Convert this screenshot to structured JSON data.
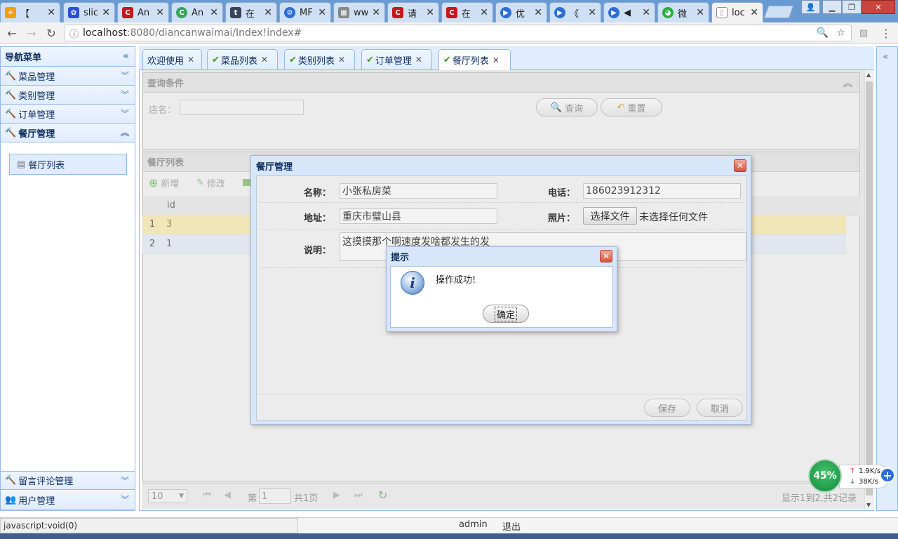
{
  "browser": {
    "tabs": [
      {
        "label": "【",
        "icon": "weather-icon",
        "color": "#f0a000"
      },
      {
        "label": "slic",
        "icon": "paw-icon",
        "color": "#2b4fd6"
      },
      {
        "label": "An",
        "icon": "c-logo-icon",
        "color": "#c8161d"
      },
      {
        "label": "An",
        "icon": "c-green-icon",
        "color": "#3aa55d"
      },
      {
        "label": "在",
        "icon": "t-icon",
        "color": "#35465c"
      },
      {
        "label": "MF",
        "icon": "gear-blue-icon",
        "color": "#2b6ed6"
      },
      {
        "label": "ww",
        "icon": "puzzle-icon",
        "color": "#888888"
      },
      {
        "label": "请",
        "icon": "c-logo-icon",
        "color": "#c8161d"
      },
      {
        "label": "在",
        "icon": "c-logo-icon",
        "color": "#c8161d"
      },
      {
        "label": "优",
        "icon": "play-icon",
        "color": "#2b6ed6"
      },
      {
        "label": "《",
        "icon": "play-icon",
        "color": "#2b6ed6"
      },
      {
        "label": "◀",
        "icon": "play-icon",
        "color": "#2b6ed6"
      },
      {
        "label": "微",
        "icon": "wechat-icon",
        "color": "#2aae3a"
      },
      {
        "label": "loc",
        "icon": "page-icon",
        "color": "#ffffff"
      }
    ],
    "url_host": "localhost",
    "url_path": ":8080/diancanwaimai/Index!index#"
  },
  "sidebar": {
    "title": "导航菜单",
    "items": [
      {
        "label": "菜品管理"
      },
      {
        "label": "类别管理"
      },
      {
        "label": "订单管理"
      },
      {
        "label": "餐厅管理"
      }
    ],
    "sub_item": "餐厅列表",
    "bottom_items": [
      {
        "label": "留言评论管理"
      },
      {
        "label": "用户管理"
      }
    ]
  },
  "tabs": [
    {
      "label": "欢迎使用"
    },
    {
      "label": "菜品列表"
    },
    {
      "label": "类别列表"
    },
    {
      "label": "订单管理"
    },
    {
      "label": "餐厅列表"
    }
  ],
  "query": {
    "title": "查询条件",
    "name_label": "店名：",
    "search_button": "查询",
    "reset_button": "重置"
  },
  "grid": {
    "title": "餐厅列表",
    "add_button": "新增",
    "edit_button": "修改",
    "column_id": "id",
    "rows": [
      {
        "num": "1",
        "id": "3"
      },
      {
        "num": "2",
        "id": "1"
      }
    ],
    "pager": {
      "page_size": "10",
      "page_prefix": "第",
      "page_value": "1",
      "page_total": "共1页",
      "summary": "显示1到2,共2记录"
    }
  },
  "dialog": {
    "title": "餐厅管理",
    "name_label": "名称：",
    "name_value": "小张私房菜",
    "phone_label": "电话：",
    "phone_value": "186023912312",
    "address_label": "地址：",
    "address_value": "重庆市璧山县",
    "photo_label": "照片：",
    "choose_file": "选择文件",
    "no_file": "未选择任何文件",
    "desc_label": "说明：",
    "desc_value": "这摸摸那个啊速度发啥都发生的发",
    "save_button": "保存",
    "cancel_button": "取消"
  },
  "alert": {
    "title": "提示",
    "message": "操作成功!",
    "ok_button": "确定"
  },
  "footer": {
    "status_url": "javascript:void(0)",
    "user": "admin",
    "logout": "退出"
  },
  "net_widget": {
    "percent": "45%",
    "up": "1.9K/s",
    "down": "38K/s"
  }
}
